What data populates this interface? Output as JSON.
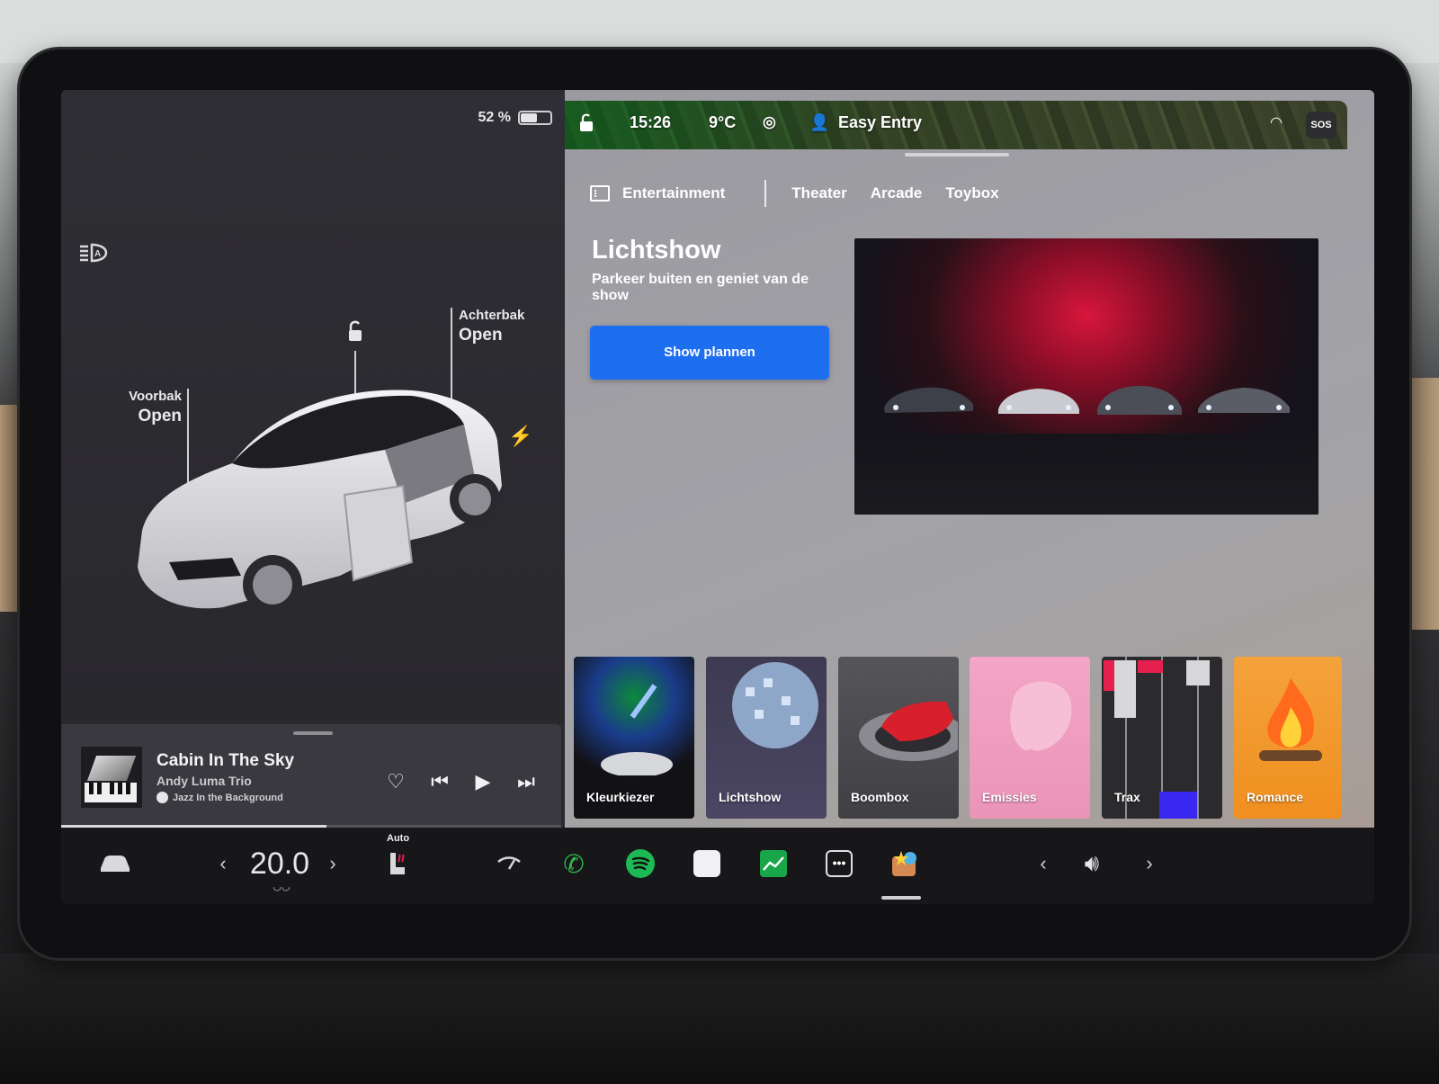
{
  "status": {
    "battery_percent": "52 %",
    "battery_level": 0.52,
    "time": "15:26",
    "temperature": "9°C",
    "profile": "Easy Entry",
    "sos": "SOS"
  },
  "car": {
    "front_trunk_label": "Voorbak",
    "front_trunk_state": "Open",
    "rear_trunk_label": "Achterbak",
    "rear_trunk_state": "Open"
  },
  "media": {
    "title": "Cabin In The Sky",
    "artist": "Andy Luma Trio",
    "source": "Jazz In the Background",
    "progress": 0.53
  },
  "entertainment": {
    "section_label": "Entertainment",
    "tabs": [
      "Theater",
      "Arcade",
      "Toybox"
    ]
  },
  "feature": {
    "title": "Lichtshow",
    "description": "Parkeer buiten en geniet van de show",
    "button_label": "Show plannen"
  },
  "tiles": [
    {
      "label": "Kleurkiezer"
    },
    {
      "label": "Lichtshow"
    },
    {
      "label": "Boombox"
    },
    {
      "label": "Emissies"
    },
    {
      "label": "Trax"
    },
    {
      "label": "Romance"
    }
  ],
  "dock": {
    "cabin_temp": "20.0",
    "seat_heat_mode": "Auto"
  },
  "colors": {
    "accent": "#1d6ff0",
    "phone": "#2fb84a",
    "spotify": "#1db954"
  }
}
